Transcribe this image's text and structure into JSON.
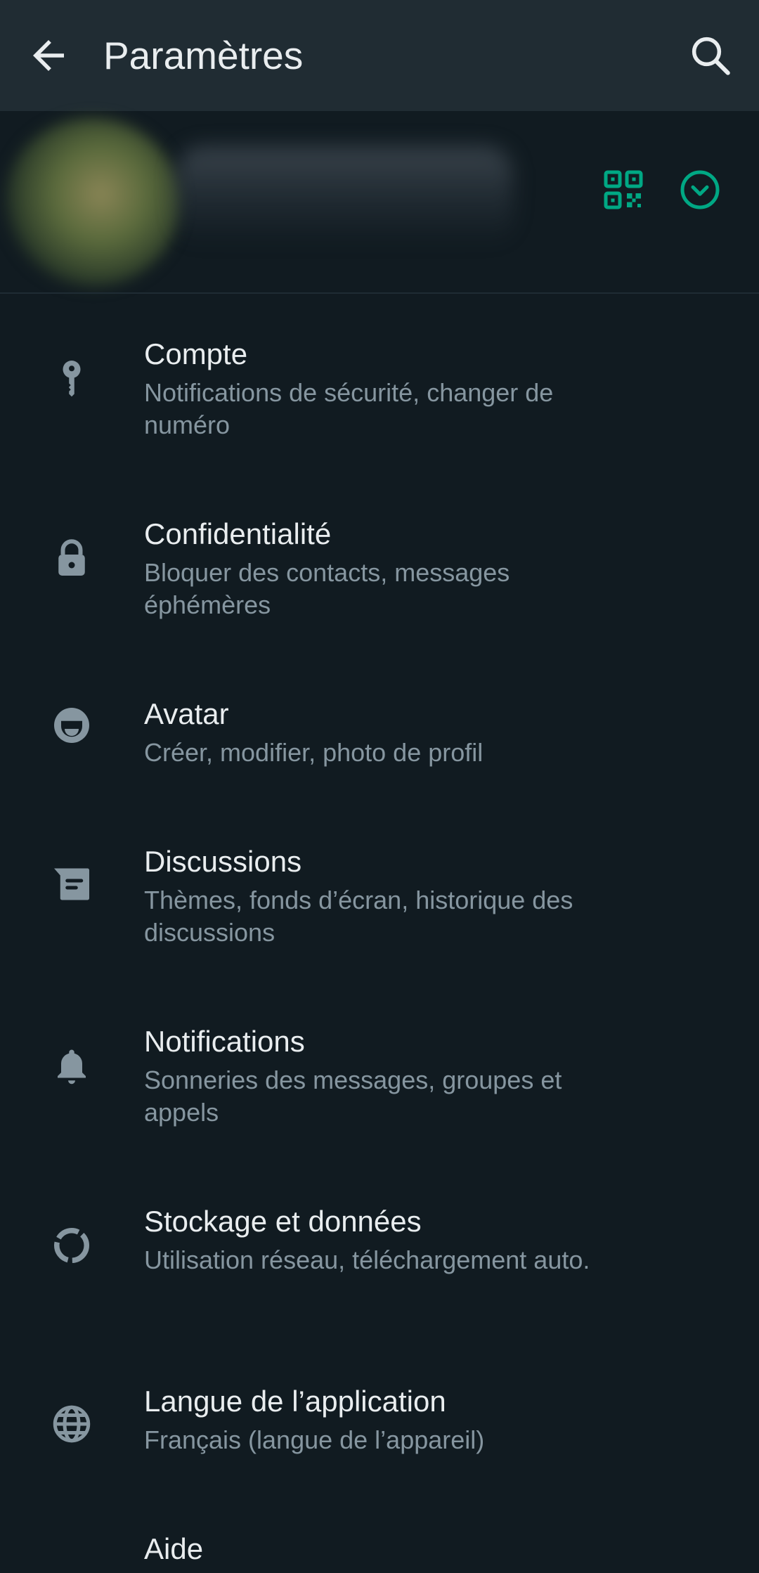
{
  "appbar": {
    "title": "Paramètres"
  },
  "colors": {
    "background": "#111b21",
    "bar": "#202c33",
    "accent": "#00a884",
    "icon": "#8696a0"
  },
  "items": [
    {
      "label": "Compte",
      "sub": "Notifications de sécurité, changer de numéro",
      "icon": "key-icon"
    },
    {
      "label": "Confidentialité",
      "sub": "Bloquer des contacts, messages éphémères",
      "icon": "lock-icon"
    },
    {
      "label": "Avatar",
      "sub": "Créer, modifier, photo de profil",
      "icon": "avatar-icon"
    },
    {
      "label": "Discussions",
      "sub": "Thèmes, fonds d’écran, historique des discussions",
      "icon": "chat-icon"
    },
    {
      "label": "Notifications",
      "sub": "Sonneries des messages, groupes et appels",
      "icon": "bell-icon"
    },
    {
      "label": "Stockage et données",
      "sub": "Utilisation réseau, téléchargement auto.",
      "icon": "storage-icon"
    },
    {
      "label": "Langue de l’application",
      "sub": "Français (langue de l’appareil)",
      "icon": "globe-icon"
    },
    {
      "label": "Aide",
      "sub": "",
      "icon": "help-icon"
    }
  ]
}
